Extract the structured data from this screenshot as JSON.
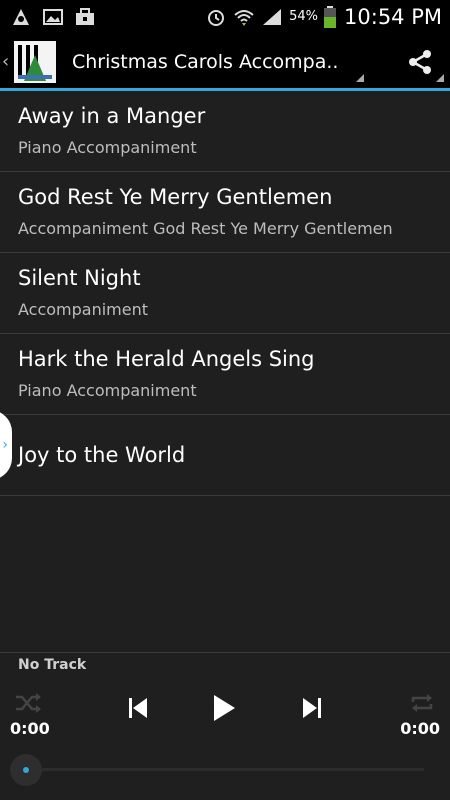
{
  "status_bar": {
    "battery_percent": "54%",
    "clock": "10:54 PM",
    "icons": [
      "notification-icon",
      "image-icon",
      "briefcase-icon",
      "alarm-icon",
      "wifi-icon",
      "signal-icon",
      "battery-icon"
    ]
  },
  "action_bar": {
    "title": "Christmas Carols Accompa..",
    "share_icon": "share-icon"
  },
  "tracks": [
    {
      "title": "Away in a Manger",
      "subtitle": "Piano Accompaniment"
    },
    {
      "title": "God Rest Ye Merry Gentlemen",
      "subtitle": "Accompaniment God Rest Ye Merry Gentlemen"
    },
    {
      "title": "Silent Night",
      "subtitle": "Accompaniment"
    },
    {
      "title": "Hark the Herald Angels Sing",
      "subtitle": "Piano Accompaniment"
    },
    {
      "title": "Joy to the World",
      "subtitle": ""
    }
  ],
  "player": {
    "now_playing": "No Track",
    "elapsed": "0:00",
    "duration": "0:00",
    "progress": 0
  },
  "colors": {
    "accent": "#33a7d8",
    "background": "#1f1f1f",
    "bar": "#000000"
  }
}
